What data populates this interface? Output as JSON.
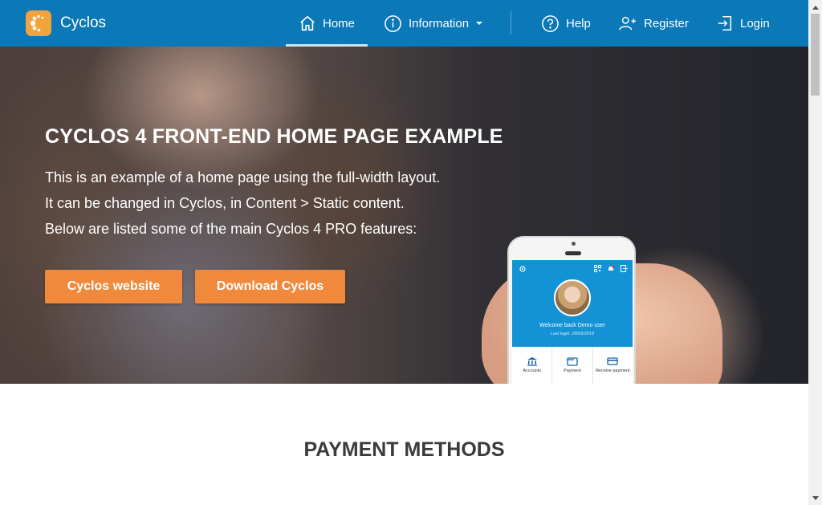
{
  "header": {
    "brand": "Cyclos",
    "nav": {
      "home": "Home",
      "information": "Information",
      "help": "Help",
      "register": "Register",
      "login": "Login"
    },
    "background_color": "#0b78b8"
  },
  "hero": {
    "title": "CYCLOS 4 FRONT-END HOME PAGE EXAMPLE",
    "lines": [
      "This is an example of a home page using the full-width layout.",
      "It can be changed in Cyclos, in Content > Static content.",
      "Below are listed some of the main Cyclos 4 PRO features:"
    ],
    "buttons": {
      "website": "Cyclos website",
      "download": "Download Cyclos"
    },
    "button_color": "#f0893c"
  },
  "phone": {
    "welcome": "Welcome back Demo user",
    "last_login": "Last login: 28/05/2019",
    "tiles": [
      "Accounts",
      "Payment",
      "Receive payment"
    ]
  },
  "section": {
    "title": "PAYMENT METHODS"
  },
  "icons": {
    "logo": "cyclos-logo-icon",
    "home": "home-icon",
    "info": "info-circle-icon",
    "help": "help-circle-icon",
    "register": "add-user-icon",
    "login": "login-icon"
  }
}
